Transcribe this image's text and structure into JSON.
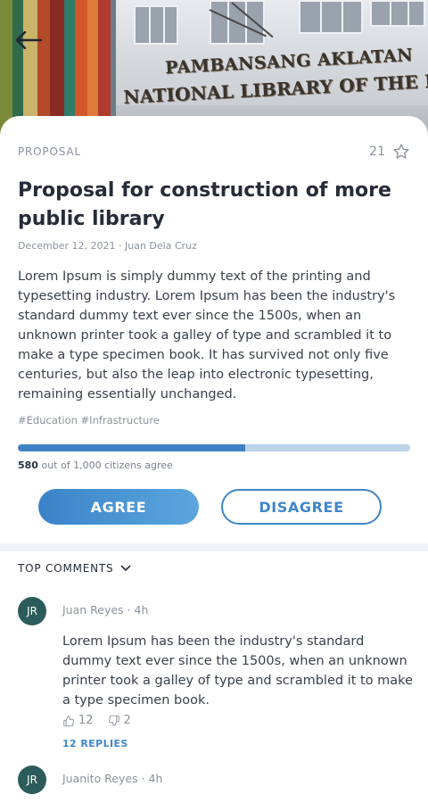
{
  "hero": {
    "sign_line_1": "PAMBANSANG AKLATAN",
    "sign_line_2": "NATIONAL LIBRARY OF THE PHILIPPINES",
    "back_icon": "arrow-left-icon"
  },
  "proposal": {
    "category": "PROPOSAL",
    "star_count": "21",
    "star_icon": "star-outline-icon",
    "title": "Proposal for construction of more public library",
    "meta": "December 12, 2021 · Juan Dela Cruz",
    "body": "Lorem Ipsum is simply dummy text of the printing and typesetting industry. Lorem Ipsum has been the industry's standard dummy text ever since the 1500s, when an unknown printer took a galley of type and scrambled it to make a type specimen book. It has survived not only five centuries, but also the leap into electronic typesetting, remaining essentially unchanged.",
    "tags": "#Education #Infrastructure",
    "agree_count": "580",
    "agree_suffix": "out of 1,000 citizens agree",
    "agree_fraction": 0.58,
    "agree_label": "AGREE",
    "disagree_label": "DISAGREE"
  },
  "comments": {
    "header": "TOP COMMENTS",
    "items": [
      {
        "initials": "JR",
        "author_line": "Juan Reyes · 4h",
        "text": "Lorem Ipsum has been the industry's standard dummy text ever since the 1500s, when an unknown printer took a galley of type and scrambled it to make a type specimen book.",
        "likes": "12",
        "dislikes": "2",
        "replies": "12 REPLIES"
      },
      {
        "initials": "JR",
        "author_line": "Juanito Reyes · 4h"
      }
    ]
  },
  "colors": {
    "accent": "#3f86c8",
    "progress_track": "#bcd3ea",
    "avatar_bg": "#2c5b5b",
    "divider": "#f1f3f8"
  }
}
